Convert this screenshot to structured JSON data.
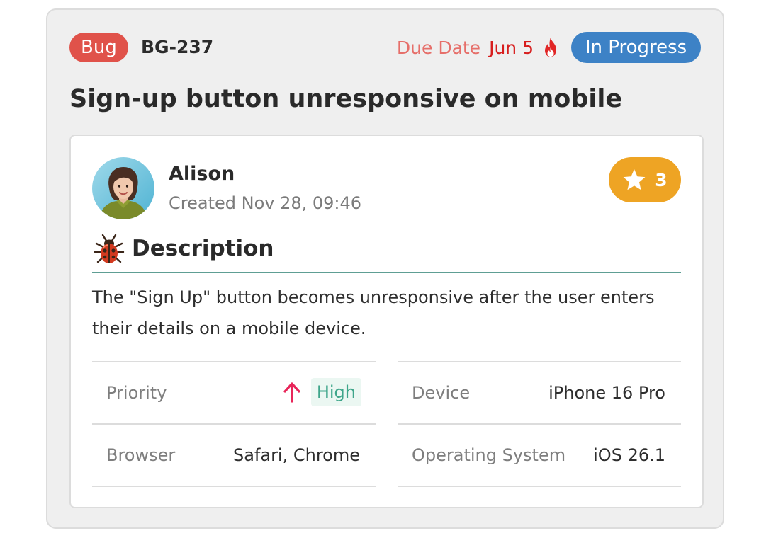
{
  "ticket": {
    "type": "Bug",
    "id": "BG-237",
    "due_label": "Due Date",
    "due_value": "Jun 5",
    "status": "In Progress",
    "title": "Sign-up button unresponsive on mobile"
  },
  "author": {
    "name": "Alison",
    "created": "Created Nov 28, 09:46"
  },
  "votes": {
    "count": "3",
    "icon": "star-icon"
  },
  "description": {
    "heading": "Description",
    "icon": "bug-icon",
    "text": "The \"Sign Up\" button becomes unresponsive after the user enters their details on a mobile device."
  },
  "details": {
    "left": [
      {
        "label": "Priority",
        "value": "High"
      },
      {
        "label": "Browser",
        "value": "Safari, Chrome"
      }
    ],
    "right": [
      {
        "label": "Device",
        "value": "iPhone 16 Pro"
      },
      {
        "label": "Operating System",
        "value": "iOS 26.1"
      }
    ]
  },
  "colors": {
    "bug_badge": "#e0524a",
    "status_badge": "#3d82c6",
    "vote_badge": "#eea424",
    "due_date": "#d71e1e",
    "priority_high": "#3ea58a",
    "priority_arrow": "#e8265a",
    "divider_accent": "#5e9e94"
  }
}
